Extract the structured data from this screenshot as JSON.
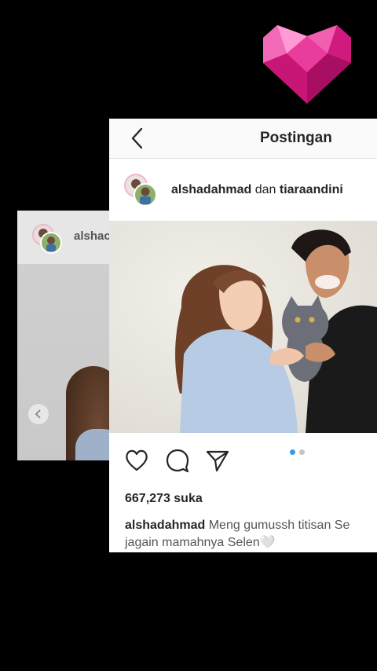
{
  "topbar": {
    "title": "Postingan"
  },
  "post": {
    "user1": "alshadahmad",
    "joiner": "dan",
    "user2": "tiaraandini",
    "likes": "667,273 suka",
    "caption_user": "alshadahmad",
    "caption_line1": "Meng gumussh titisan Se",
    "caption_line2": "jagain mamahnya Selen",
    "caption_emoji": "🤍",
    "carousel": {
      "count": 2,
      "active": 1
    }
  },
  "background_card": {
    "username": "alshac"
  },
  "colors": {
    "accent": "#3897f0",
    "heart_pink": "#e0218a"
  }
}
